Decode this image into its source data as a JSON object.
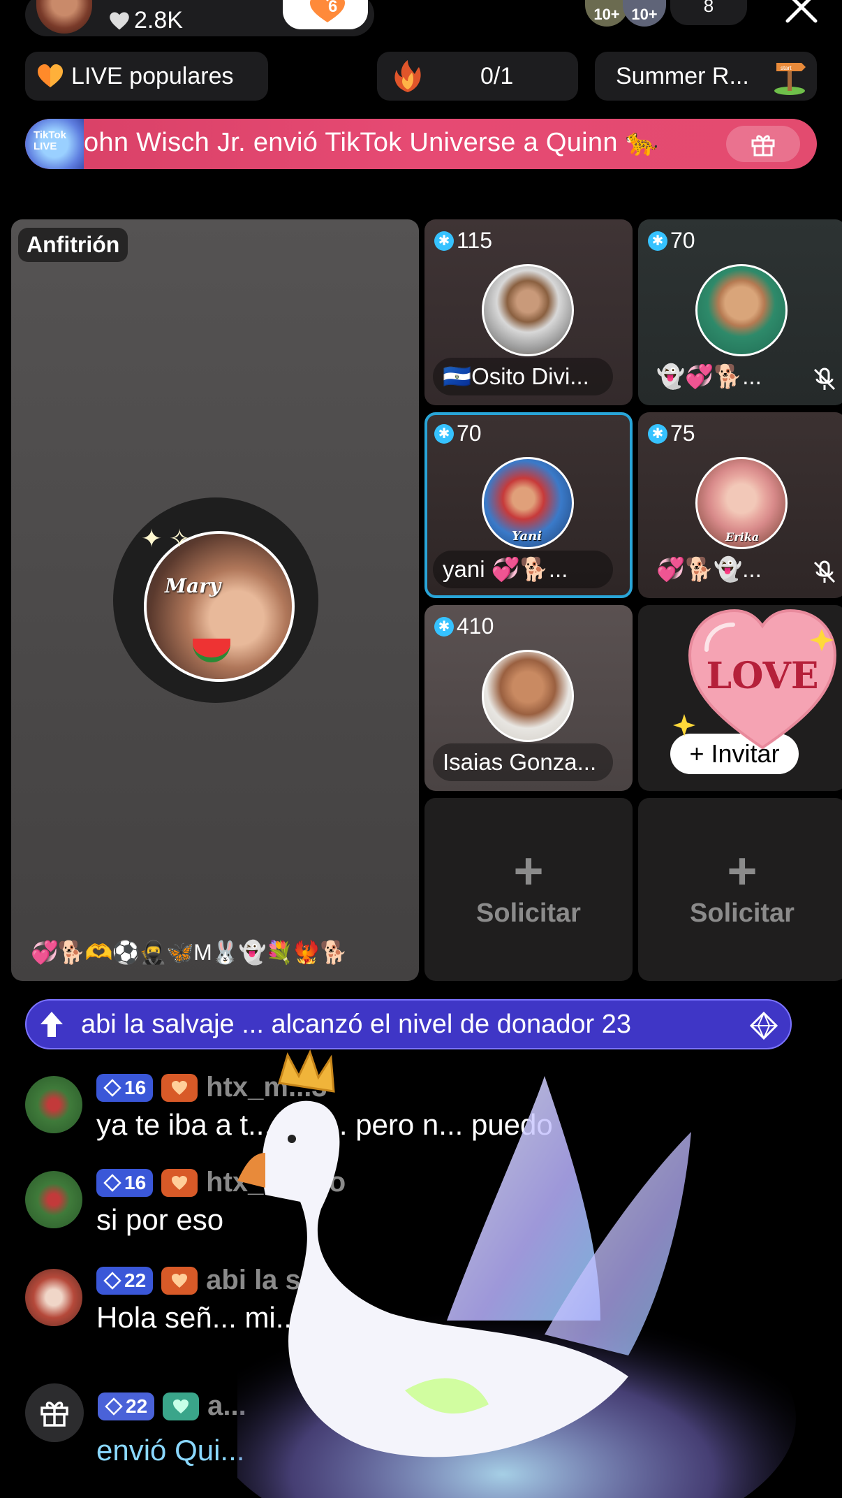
{
  "topbar": {
    "likes": "2.8K",
    "follow_badge": "6",
    "viewer_bubbles": [
      "10+",
      "10+"
    ],
    "viewer_count": "8"
  },
  "chips": {
    "popular": "LIVE populares",
    "match": "0/1",
    "summer": "Summer R..."
  },
  "gift_banner": {
    "logo": "TikTok LIVE",
    "text": "ohn Wisch Jr. envió TikTok Universe a Quinn 🐆"
  },
  "host": {
    "role": "Anfitrión",
    "photo_tag": "Mary",
    "emojis": "💞🐕🫶⚽🥷🦋M🐰👻💐🐦‍🔥🐕"
  },
  "guests": [
    {
      "score": "115",
      "name": "🇸🇻Osito Divi...",
      "muted": false
    },
    {
      "score": "70",
      "name": "👻💞🐕...",
      "muted": true
    },
    {
      "score": "70",
      "name": "yani 💞🐕...",
      "muted": false,
      "photo_tag": "Yani"
    },
    {
      "score": "75",
      "name": "💞🐕👻...",
      "muted": true,
      "photo_tag": "Erika"
    },
    {
      "score": "410",
      "name": "Isaias Gonza...",
      "muted": false
    }
  ],
  "invite": {
    "label": "+ Invitar"
  },
  "sticker": {
    "text": "LOVE"
  },
  "request_slots": [
    "Solicitar",
    "Solicitar"
  ],
  "donor_banner": {
    "text": "abi la salvaje ... alcanzó el nivel de donador 23"
  },
  "chat": [
    {
      "level": "16",
      "user": "htx_m...3",
      "message": "ya te iba a t... ere... pero n... puedo"
    },
    {
      "level": "16",
      "user": "htx_mateo",
      "message": "si por eso"
    },
    {
      "level": "22",
      "user": "abi la s...",
      "message": "Hola señ... mi..."
    },
    {
      "level": "22",
      "user": "a...",
      "message": "envió Qui..."
    }
  ],
  "colors": {
    "accent_blue": "#29a5d8",
    "banner_pink": "#e34b6f",
    "donor_purple": "#3f36c6",
    "level_blue": "#3a57d8"
  }
}
